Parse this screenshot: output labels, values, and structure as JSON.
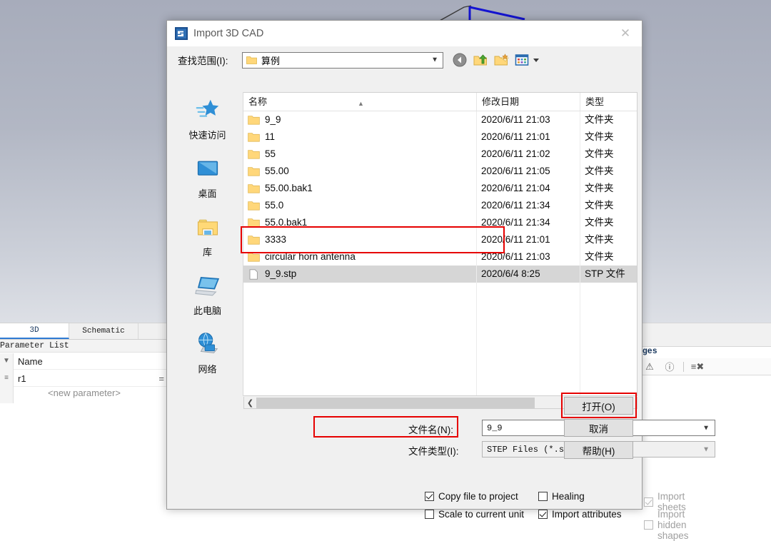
{
  "background": {
    "left_dock": {
      "tabs": [
        {
          "label": "3D",
          "active": true
        },
        {
          "label": "Schematic",
          "active": false
        }
      ],
      "panel_title": "Parameter List",
      "grid": {
        "header": "Name",
        "rows": [
          {
            "name": "r1",
            "equals": "="
          }
        ],
        "new_row_placeholder": "<new parameter>",
        "gutter_icons": [
          "filter-icon",
          "variable-icon"
        ]
      }
    },
    "right_dock": {
      "title": "ages",
      "toolbar_icons": [
        "warning-icon",
        "info-icon",
        "clear-messages-icon"
      ]
    }
  },
  "dialog": {
    "title": "Import 3D CAD",
    "app_icon": "simulia-logo-icon",
    "close_icon": "close-icon",
    "lookin": {
      "label": "查找范围(I):",
      "value": "算例",
      "folder_icon": "folder-icon",
      "dropdown_icon": "chevron-down-icon"
    },
    "nav_tools": [
      {
        "name": "back-button",
        "icon": "back-arrow-icon"
      },
      {
        "name": "up-one-level-button",
        "icon": "folder-up-icon"
      },
      {
        "name": "create-new-folder-button",
        "icon": "new-folder-icon"
      },
      {
        "name": "views-button",
        "icon": "views-icon"
      }
    ],
    "places": [
      {
        "label": "快速访问",
        "icon": "quick-access-star-icon"
      },
      {
        "label": "桌面",
        "icon": "desktop-monitor-icon"
      },
      {
        "label": "库",
        "icon": "library-folder-icon"
      },
      {
        "label": "此电脑",
        "icon": "this-pc-icon"
      },
      {
        "label": "网络",
        "icon": "network-globe-icon"
      }
    ],
    "file_list": {
      "columns": [
        "名称",
        "修改日期",
        "类型"
      ],
      "sort_indicator": "caret-up-icon",
      "rows": [
        {
          "name": "9_9",
          "date": "2020/6/11 21:03",
          "type": "文件夹",
          "icon": "folder-icon",
          "selected": false
        },
        {
          "name": "11",
          "date": "2020/6/11 21:01",
          "type": "文件夹",
          "icon": "folder-icon",
          "selected": false
        },
        {
          "name": "55",
          "date": "2020/6/11 21:02",
          "type": "文件夹",
          "icon": "folder-icon",
          "selected": false
        },
        {
          "name": "55.00",
          "date": "2020/6/11 21:05",
          "type": "文件夹",
          "icon": "folder-icon",
          "selected": false
        },
        {
          "name": "55.00.bak1",
          "date": "2020/6/11 21:04",
          "type": "文件夹",
          "icon": "folder-icon",
          "selected": false
        },
        {
          "name": "55.0",
          "date": "2020/6/11 21:34",
          "type": "文件夹",
          "icon": "folder-icon",
          "selected": false
        },
        {
          "name": "55.0.bak1",
          "date": "2020/6/11 21:34",
          "type": "文件夹",
          "icon": "folder-icon",
          "selected": false
        },
        {
          "name": "3333",
          "date": "2020/6/11 21:01",
          "type": "文件夹",
          "icon": "folder-icon",
          "selected": false
        },
        {
          "name": "circular horn antenna",
          "date": "2020/6/11 21:03",
          "type": "文件夹",
          "icon": "folder-icon",
          "selected": false
        },
        {
          "name": "9_9.stp",
          "date": "2020/6/4 8:25",
          "type": "STP 文件",
          "icon": "file-icon",
          "selected": true
        }
      ],
      "scrollbar": {
        "left_arrow": "chevron-left-icon",
        "right_arrow": "chevron-right-icon"
      }
    },
    "fields": {
      "filename_label": "文件名(N):",
      "filename_value": "9_9",
      "filetype_label": "文件类型(I):",
      "filetype_value": "STEP Files (*.stp; *.step)"
    },
    "buttons": {
      "open": "打开(O)",
      "cancel": "取消",
      "help": "帮助(H)"
    },
    "options": [
      {
        "label": "Copy file to project",
        "checked": true,
        "disabled": false
      },
      {
        "label": "Scale to current unit",
        "checked": false,
        "disabled": false
      },
      {
        "label": "Healing",
        "checked": false,
        "disabled": false
      },
      {
        "label": "Import attributes",
        "checked": true,
        "disabled": false
      },
      {
        "label": "Import sheets",
        "checked": true,
        "disabled": true
      },
      {
        "label": "Import hidden shapes",
        "checked": false,
        "disabled": true
      }
    ]
  },
  "annotations": {
    "highlight_color": "#e60000",
    "boxes": [
      {
        "name": "selected-files-highlight"
      },
      {
        "name": "filetype-highlight"
      },
      {
        "name": "open-button-highlight"
      }
    ]
  }
}
